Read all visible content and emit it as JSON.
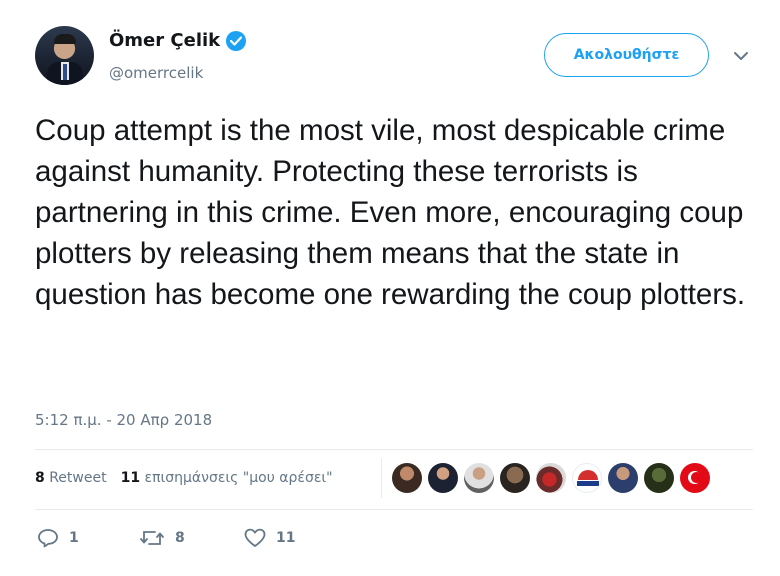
{
  "header": {
    "display_name": "Ömer Çelik",
    "handle": "@omerrcelik",
    "follow_label": "Ακολουθήστε"
  },
  "tweet": {
    "text": "Coup attempt is the most vile, most despicable crime against humanity. Protecting these terrorists is partnering in this crime. Even more, encouraging coup plotters by releasing them means that the state in question has become one rewarding the coup plotters.",
    "timestamp": "5:12 π.μ. - 20 Απρ 2018"
  },
  "stats": {
    "retweets_count": "8",
    "retweets_label": "Retweet",
    "likes_count": "11",
    "likes_label": "επισημάνσεις \"μου αρέσει\""
  },
  "actions": {
    "reply_count": "1",
    "retweet_count": "8",
    "like_count": "11"
  },
  "icons": [
    "verified-icon",
    "chevron-down-icon",
    "reply-icon",
    "retweet-icon",
    "heart-icon"
  ],
  "colors": {
    "accent": "#1da1f2",
    "muted": "#657786",
    "text": "#14171a"
  }
}
